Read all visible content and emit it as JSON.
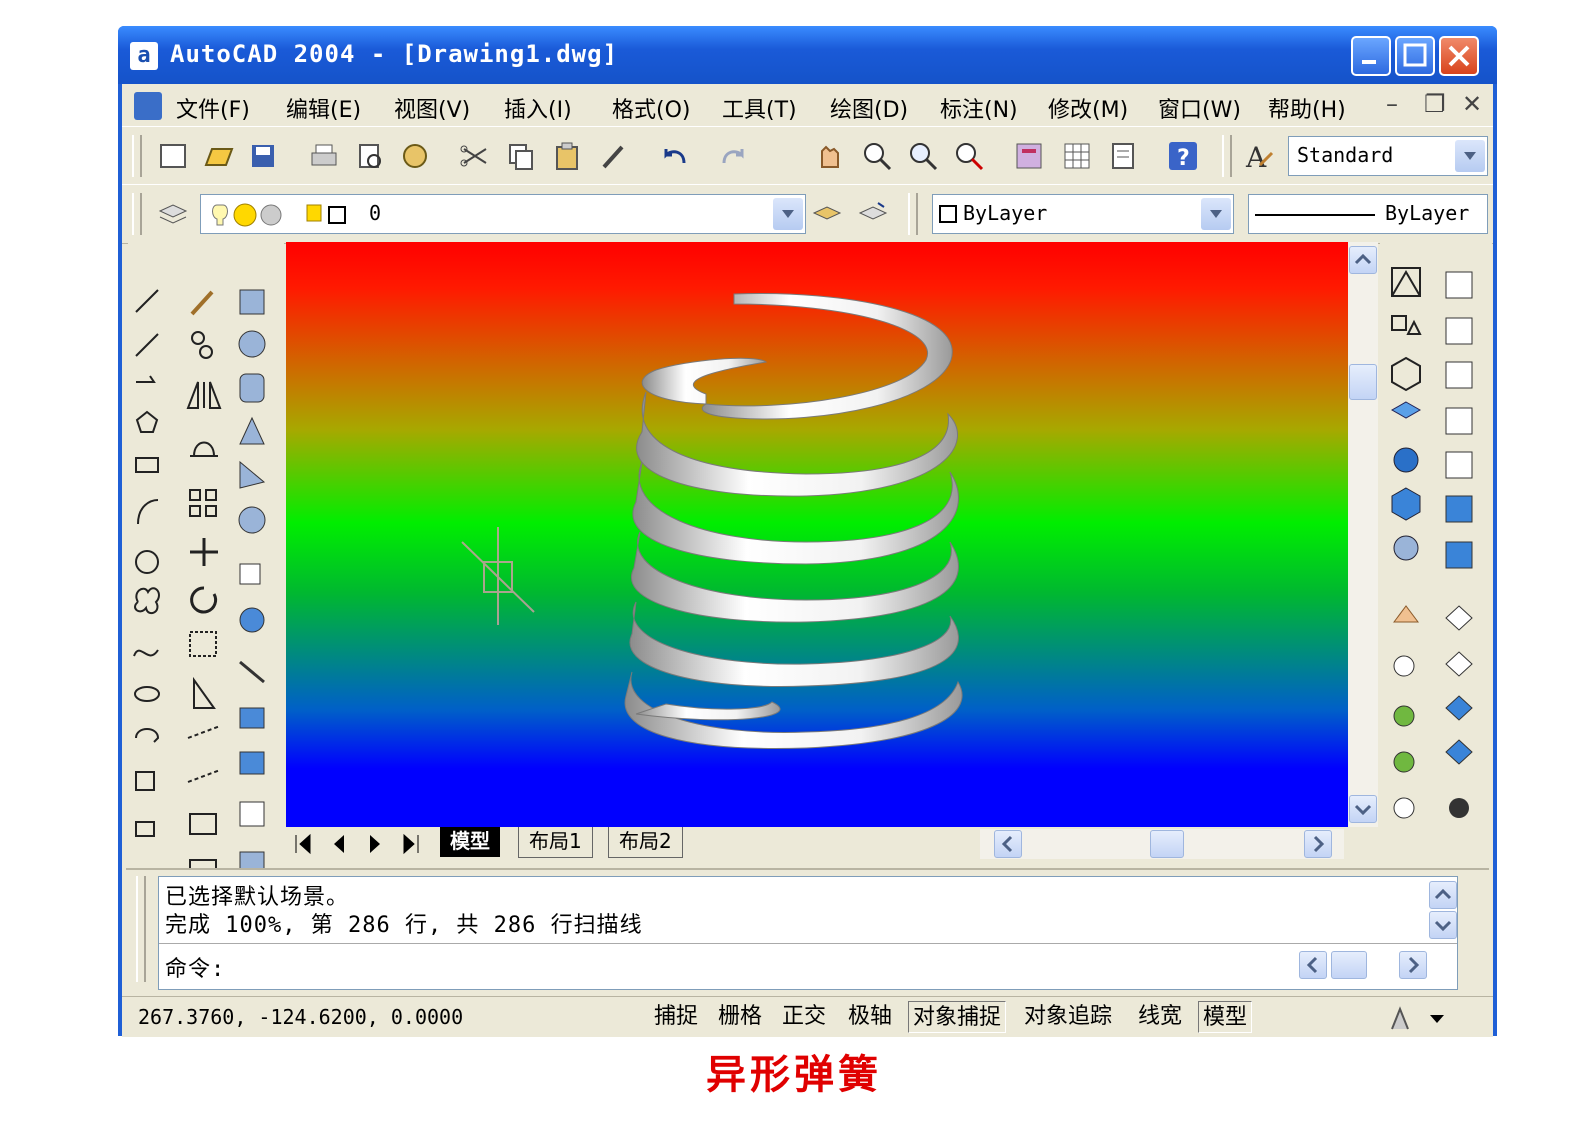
{
  "window": {
    "title": "AutoCAD 2004 - [Drawing1.dwg]",
    "app_icon": "a"
  },
  "menu": {
    "items": [
      "文件(F)",
      "编辑(E)",
      "视图(V)",
      "插入(I)",
      "格式(O)",
      "工具(T)",
      "绘图(D)",
      "标注(N)",
      "修改(M)",
      "窗口(W)",
      "帮助(H)"
    ]
  },
  "toolbar": {
    "text_style": "Standard",
    "layer": "0",
    "color": "ByLayer",
    "linetype": "ByLayer"
  },
  "layout_tabs": [
    "模型",
    "布局1",
    "布局2"
  ],
  "command": {
    "lines": [
      "已选择默认场景。",
      "完成 100%, 第 286 行, 共 286 行扫描线"
    ],
    "prompt": "命令:"
  },
  "status": {
    "coords": "267.3760,   -124.6200,  0.0000",
    "toggles": [
      "捕捉",
      "栅格",
      "正交",
      "极轴",
      "对象捕捉",
      "对象追踪",
      "线宽",
      "模型"
    ]
  },
  "caption": "异形弹簧",
  "colors": {
    "title_blue": "#1f5fd6",
    "caption_red": "#e00000",
    "viewport_top": "#ff0000",
    "viewport_mid": "#00ee00",
    "viewport_bottom": "#0000ff"
  }
}
